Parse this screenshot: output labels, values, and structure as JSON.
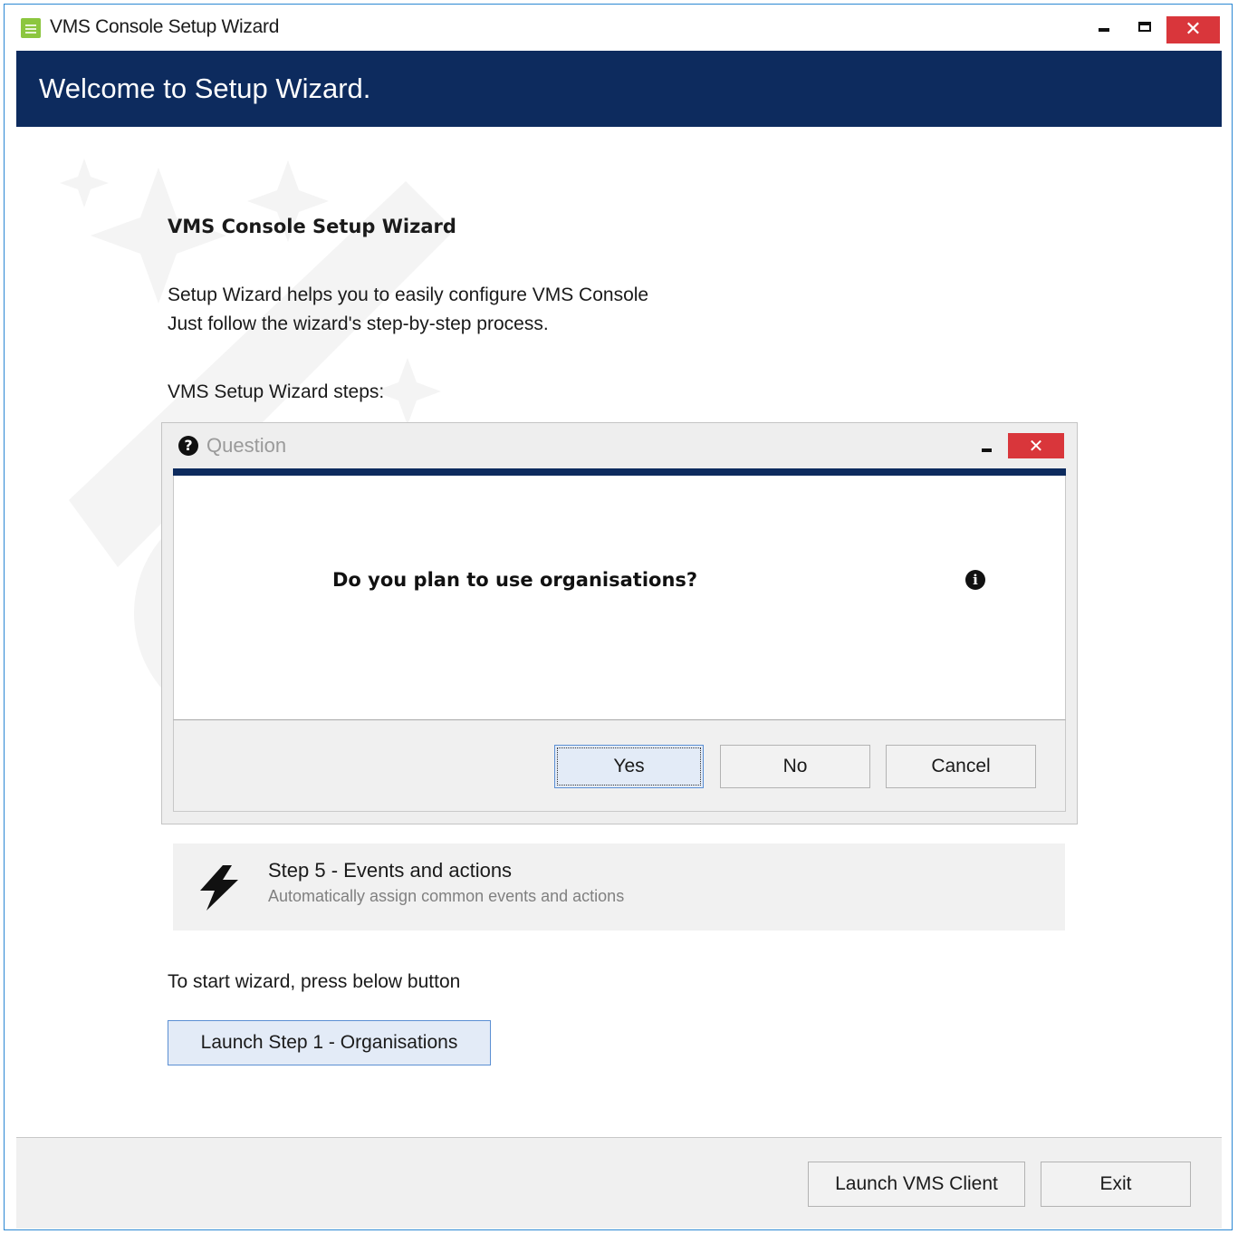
{
  "window": {
    "title": "VMS Console Setup Wizard",
    "close_glyph": "✕"
  },
  "header": {
    "title": "Welcome to Setup Wizard."
  },
  "intro": {
    "title": "VMS Console Setup Wizard",
    "line1": "Setup Wizard helps you to easily configure VMS Console",
    "line2": "Just follow the wizard's step-by-step process.",
    "steps_label": "VMS Setup Wizard steps:"
  },
  "dialog": {
    "title": "Question",
    "question": "Do you plan to use organisations?",
    "close_glyph": "✕",
    "buttons": {
      "yes": "Yes",
      "no": "No",
      "cancel": "Cancel"
    }
  },
  "step5": {
    "title": "Step 5 - Events and actions",
    "description": "Automatically assign common events and actions",
    "icon": "lightning-icon"
  },
  "start": {
    "label": "To start wizard, press below button",
    "button": "Launch Step 1 - Organisations"
  },
  "footer": {
    "launch_client": "Launch VMS Client",
    "exit": "Exit"
  },
  "colors": {
    "header_bg": "#0d2b5e",
    "close_red": "#d9363b",
    "accent_blue": "#5b8fd3",
    "app_icon_green": "#8cc63f"
  }
}
